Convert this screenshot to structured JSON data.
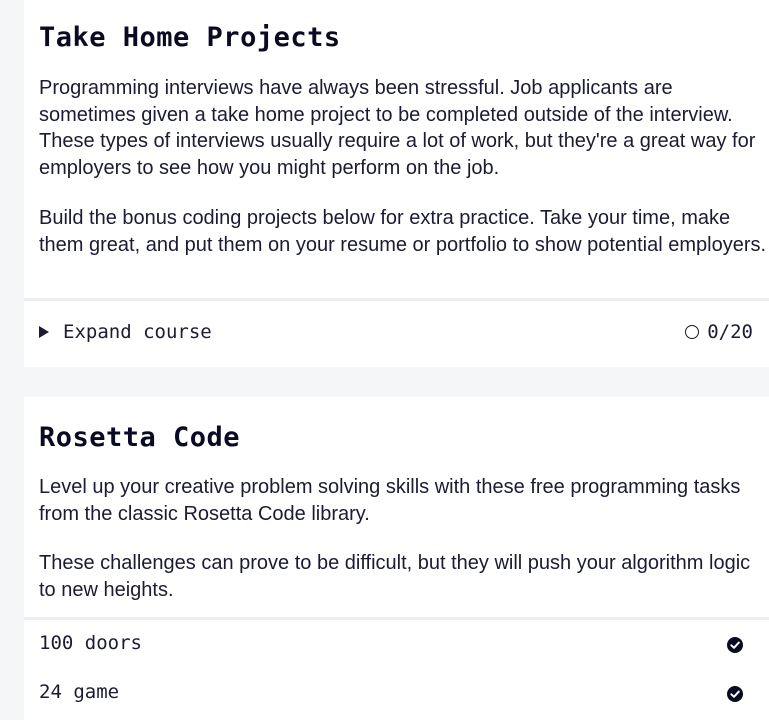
{
  "take_home": {
    "title": "Take Home Projects",
    "paragraphs": [
      "Programming interviews have always been stressful. Job applicants are sometimes given a take home project to be completed outside of the interview. These types of interviews usually require a lot of work, but they're a great way for employers to see how you might perform on the job.",
      "Build the bonus coding projects below for extra practice. Take your time, make them great, and put them on your resume or portfolio to show potential employers."
    ],
    "expand_label": "Expand course",
    "progress": "0/20"
  },
  "rosetta": {
    "title": "Rosetta Code",
    "paragraphs": [
      "Level up your creative problem solving skills with these free programming tasks from the classic Rosetta Code library.",
      "These challenges can prove to be difficult, but they will push your algorithm logic to new heights."
    ],
    "challenges": [
      {
        "name": "100 doors",
        "completed": true
      },
      {
        "name": "24 game",
        "completed": true
      }
    ]
  },
  "icons": {
    "expand": "triangle-right-icon",
    "progress": "circle-outline-icon",
    "completed": "check-circle-icon"
  },
  "colors": {
    "text": "#0a0a23",
    "background": "#f5f6f7",
    "card": "#ffffff"
  }
}
